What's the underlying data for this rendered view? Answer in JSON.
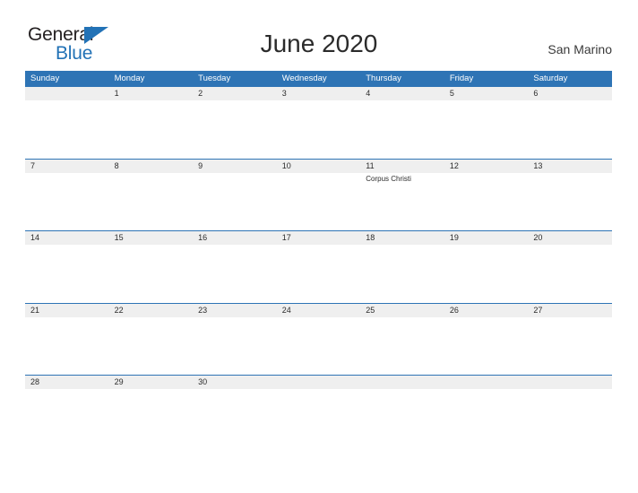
{
  "brand": {
    "name_part1": "General",
    "name_part2": "Blue",
    "color_dark": "#231f20",
    "color_blue": "#2272b6",
    "triangle_icon": "blue-triangle-icon"
  },
  "header": {
    "title": "June 2020",
    "location": "San Marino"
  },
  "theme": {
    "header_blue": "#2e74b5",
    "row_divider_blue": "#2e74b5",
    "date_band_gray": "#efefef",
    "text_dark": "#2b2b2b",
    "text_white": "#ffffff"
  },
  "weekdays": [
    "Sunday",
    "Monday",
    "Tuesday",
    "Wednesday",
    "Thursday",
    "Friday",
    "Saturday"
  ],
  "weeks": [
    {
      "days": [
        {
          "date": "",
          "events": []
        },
        {
          "date": "1",
          "events": []
        },
        {
          "date": "2",
          "events": []
        },
        {
          "date": "3",
          "events": []
        },
        {
          "date": "4",
          "events": []
        },
        {
          "date": "5",
          "events": []
        },
        {
          "date": "6",
          "events": []
        }
      ]
    },
    {
      "days": [
        {
          "date": "7",
          "events": []
        },
        {
          "date": "8",
          "events": []
        },
        {
          "date": "9",
          "events": []
        },
        {
          "date": "10",
          "events": []
        },
        {
          "date": "11",
          "events": [
            "Corpus Christi"
          ]
        },
        {
          "date": "12",
          "events": []
        },
        {
          "date": "13",
          "events": []
        }
      ]
    },
    {
      "days": [
        {
          "date": "14",
          "events": []
        },
        {
          "date": "15",
          "events": []
        },
        {
          "date": "16",
          "events": []
        },
        {
          "date": "17",
          "events": []
        },
        {
          "date": "18",
          "events": []
        },
        {
          "date": "19",
          "events": []
        },
        {
          "date": "20",
          "events": []
        }
      ]
    },
    {
      "days": [
        {
          "date": "21",
          "events": []
        },
        {
          "date": "22",
          "events": []
        },
        {
          "date": "23",
          "events": []
        },
        {
          "date": "24",
          "events": []
        },
        {
          "date": "25",
          "events": []
        },
        {
          "date": "26",
          "events": []
        },
        {
          "date": "27",
          "events": []
        }
      ]
    },
    {
      "days": [
        {
          "date": "28",
          "events": []
        },
        {
          "date": "29",
          "events": []
        },
        {
          "date": "30",
          "events": []
        },
        {
          "date": "",
          "events": []
        },
        {
          "date": "",
          "events": []
        },
        {
          "date": "",
          "events": []
        },
        {
          "date": "",
          "events": []
        }
      ]
    }
  ]
}
